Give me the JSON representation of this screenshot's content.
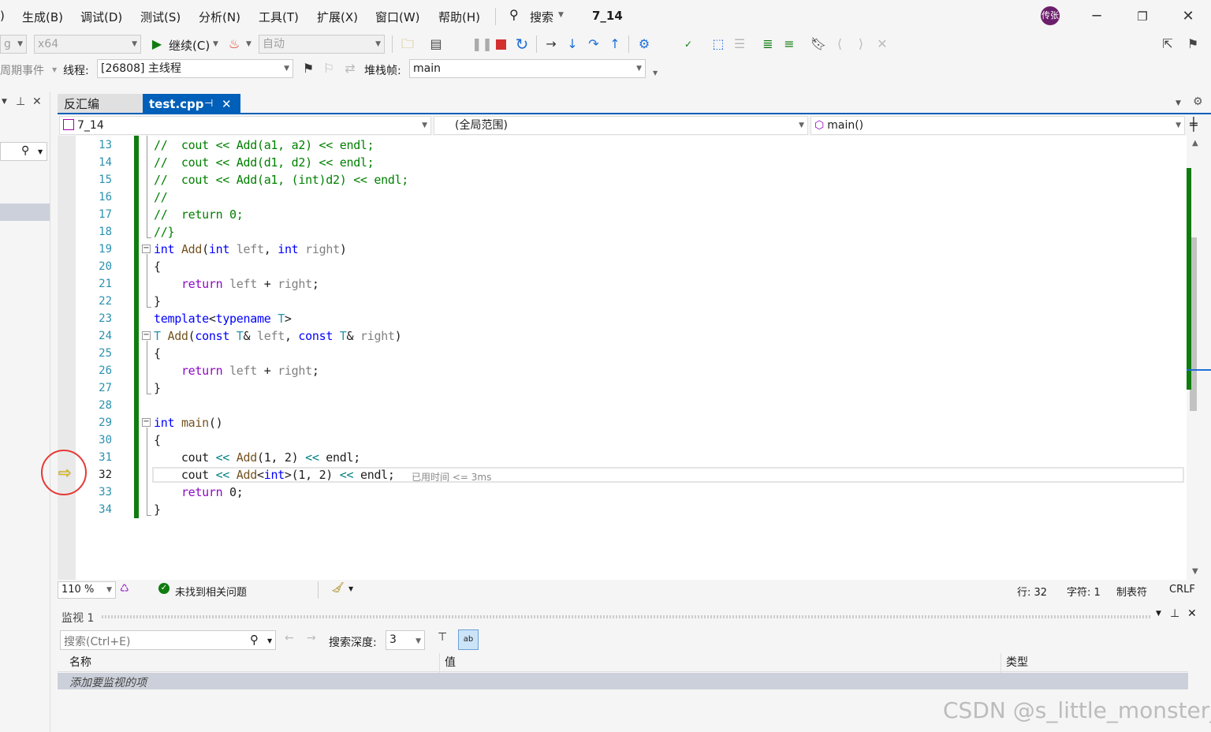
{
  "menu": {
    "paren": ")",
    "items": [
      "生成(B)",
      "调试(D)",
      "测试(S)",
      "分析(N)",
      "工具(T)",
      "扩展(X)",
      "窗口(W)",
      "帮助(H)"
    ],
    "search": "搜索",
    "solution_name": "7_14",
    "avatar": "传张"
  },
  "toolbar": {
    "config": "g",
    "platform": "x64",
    "continue": "继续(C)",
    "auto": "自动",
    "lifecycle": "周期事件",
    "thread_label": "线程:",
    "thread_value": "[26808] 主线程",
    "stackframe_label": "堆栈帧:",
    "stackframe_value": "main"
  },
  "tabs": [
    {
      "label": "反汇编",
      "active": false
    },
    {
      "label": "test.cpp",
      "active": true
    }
  ],
  "navbar": {
    "project": "7_14",
    "scope": "(全局范围)",
    "function": "main()"
  },
  "editor": {
    "line_numbers": [
      "13",
      "14",
      "15",
      "16",
      "17",
      "18",
      "19",
      "20",
      "21",
      "22",
      "23",
      "24",
      "25",
      "26",
      "27",
      "28",
      "29",
      "30",
      "31",
      "32",
      "33",
      "34"
    ],
    "current_line": "32",
    "perf_tip": "已用时间 <= 3ms",
    "colors": {
      "keyword": "#0000ff",
      "comment": "#008000",
      "type": "#2b91af",
      "control": "#8f08c4",
      "change_bar": "#107c10"
    }
  },
  "status": {
    "zoom": "110 %",
    "issues": "未找到相关问题",
    "line": "行: 32",
    "char": "字符: 1",
    "tabs": "制表符",
    "eol": "CRLF"
  },
  "watch": {
    "title": "监视 1",
    "search_placeholder": "搜索(Ctrl+E)",
    "depth_label": "搜索深度:",
    "depth_value": "3",
    "columns": [
      "名称",
      "值",
      "类型"
    ],
    "add_item": "添加要监视的项"
  },
  "watermark": "CSDN @s_little_monster_"
}
